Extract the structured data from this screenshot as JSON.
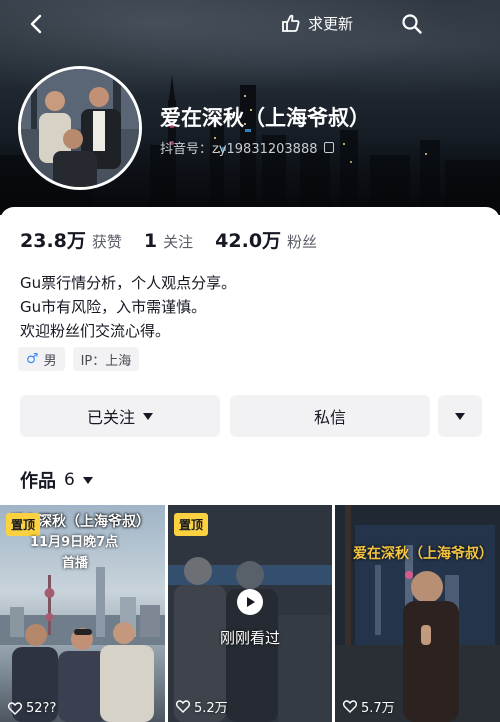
{
  "header": {
    "update_label": "求更新",
    "nickname": "爱在深秋（上海爷叔）",
    "douyin_id": "抖音号：zy19831203888"
  },
  "stats": {
    "likes_count": "23.8万",
    "likes_label": "获赞",
    "following_count": "1",
    "following_label": "关注",
    "followers_count": "42.0万",
    "followers_label": "粉丝"
  },
  "bio": {
    "line1": "Gu票行情分析，个人观点分享。",
    "line2": "Gu市有风险，入市需谨慎。",
    "line3": "欢迎粉丝们交流心得。"
  },
  "tags": {
    "gender": "男",
    "ip": "IP：上海"
  },
  "actions": {
    "follow_label": "已关注",
    "message_label": "私信"
  },
  "works": {
    "tab_label": "作品",
    "count": "6"
  },
  "videos": [
    {
      "pin_label": "置顶",
      "cover_title": "爱在深秋（上海爷叔）",
      "cover_sub": "11月9日晚7点",
      "cover_premiere": "首播",
      "likes": "52??"
    },
    {
      "pin_label": "置顶",
      "watched_label": "刚刚看过",
      "likes": "5.2万"
    },
    {
      "cover_title": "爱在深秋（上海爷叔）",
      "likes": "5.7万"
    }
  ],
  "colors": {
    "accent_pin": "#fbd13f",
    "gender_male": "#3d8bf7",
    "button_bg": "#f2f2f4",
    "cover_title_red": "#e84a3c"
  }
}
